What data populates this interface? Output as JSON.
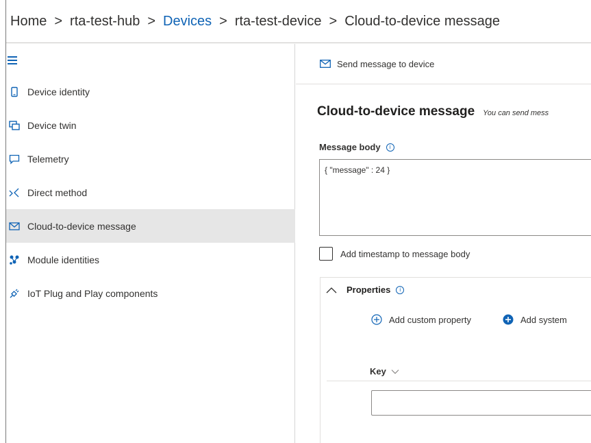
{
  "breadcrumb": [
    {
      "label": "Home",
      "link": false
    },
    {
      "label": "rta-test-hub",
      "link": false
    },
    {
      "label": "Devices",
      "link": true
    },
    {
      "label": "rta-test-device",
      "link": false
    },
    {
      "label": "Cloud-to-device message",
      "link": false
    }
  ],
  "breadcrumb_separator": ">",
  "sidebar": {
    "items": [
      {
        "label": "Device identity",
        "icon": "phone-icon"
      },
      {
        "label": "Device twin",
        "icon": "device-twin-icon"
      },
      {
        "label": "Telemetry",
        "icon": "chat-icon"
      },
      {
        "label": "Direct method",
        "icon": "direct-method-icon"
      },
      {
        "label": "Cloud-to-device message",
        "icon": "envelope-icon",
        "active": true
      },
      {
        "label": "Module identities",
        "icon": "module-icon"
      },
      {
        "label": "IoT Plug and Play components",
        "icon": "plug-icon"
      }
    ]
  },
  "command_bar": {
    "send_label": "Send message to device"
  },
  "main": {
    "title": "Cloud-to-device message",
    "description": "You can send mess",
    "message_body_label": "Message body",
    "message_body_value": "{ \"message\" : 24 }",
    "timestamp_checkbox_label": "Add timestamp to message body",
    "properties": {
      "header": "Properties",
      "add_custom_label": "Add custom property",
      "add_system_label": "Add system",
      "key_column": "Key",
      "key_value": ""
    }
  },
  "colors": {
    "link": "#0f63b5",
    "active_nav": "#e6e6e6",
    "text": "#323130"
  }
}
